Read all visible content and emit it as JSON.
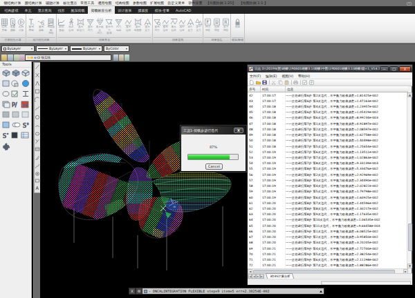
{
  "menubar": {
    "items": [
      "钢结构计算",
      "膜结构计算",
      "辅助计算",
      "标注显示",
      "常用工具",
      "通用绘图",
      "结构绘图",
      "参数绘图",
      "扩展绘图",
      "自定义菜单",
      "软件设置",
      "【出图比例 1:25】",
      "【绘图比例 1:1 】"
    ]
  },
  "tabbar": {
    "tabs": [
      {
        "label": "结构建模",
        "active": false
      },
      {
        "label": "单元",
        "active": false
      },
      {
        "label": "显示查询",
        "active": false
      },
      {
        "label": "找形",
        "active": false
      },
      {
        "label": "施加荷载",
        "active": false
      },
      {
        "label": "荷载效应分析",
        "active": true
      },
      {
        "label": "设计验算",
        "active": false
      },
      {
        "label": "膜裁剪",
        "active": false
      },
      {
        "label": "模块·变量",
        "active": false
      },
      {
        "label": "AutoCAD",
        "active": false
      }
    ],
    "minimize_icon": "chevron-up"
  },
  "ribbon": {
    "groups": [
      {
        "label": "自振特性计算",
        "items": [
          {
            "label": "结构\n类型",
            "icon": "grid"
          },
          {
            "label": "检查\n模型",
            "icon": "doc"
          },
          {
            "label": "结构\n计算",
            "icon": "play"
          }
        ]
      },
      {
        "label": "动力特性结果",
        "items": [
          {
            "label": "查询\n周期",
            "icon": "tletter"
          },
          {
            "label": "查询\n振型",
            "icon": "wave"
          },
          {
            "label": "周期振型\n报告",
            "icon": "report"
          }
        ]
      },
      {
        "label": "结果显示",
        "items": [
          {
            "label": "时程\n曲线",
            "icon": "curve"
          },
          {
            "label": "动态\n位移",
            "icon": "person"
          },
          {
            "label": "显示\n膜应力",
            "icon": "xmesh"
          },
          {
            "label": "显示\n内力",
            "icon": "vee"
          },
          {
            "label": "最大组合\n内力",
            "icon": "veemax"
          },
          {
            "label": "显示内力\n数值",
            "icon": "veenum"
          },
          {
            "label": "内力\n包络",
            "icon": "vee"
          },
          {
            "label": "显示\n位移",
            "icon": "zz"
          },
          {
            "label": "显示\n膜曲面",
            "icon": "xmesh"
          },
          {
            "label": "显示\n反力",
            "icon": "tri"
          }
        ]
      },
      {
        "label": "结果查询",
        "items": [
          {
            "label": "查询\n内力",
            "icon": "vq"
          },
          {
            "label": "查询\n位移",
            "icon": "zz"
          },
          {
            "label": "最大\n位移",
            "icon": "zmax"
          },
          {
            "label": "相对\n位移",
            "icon": "zz"
          },
          {
            "label": "单个\n反力",
            "icon": "tri"
          },
          {
            "label": "多个\n反力",
            "icon": "tri2"
          }
        ]
      },
      {
        "label": "结果报告",
        "items": [
          {
            "label": "内力\n报告",
            "icon": "boxF",
            "letter": "F"
          },
          {
            "label": "位移\n报告",
            "icon": "boxD",
            "letter": "D"
          },
          {
            "label": "反力\n报告",
            "icon": "boxR",
            "letter": "R"
          }
        ]
      },
      {
        "label": "锁定/解锁",
        "items": [
          {
            "label": "锁定",
            "icon": "lock"
          }
        ]
      }
    ]
  },
  "props_toolbar": {
    "color_value": "ByLayer",
    "linetype_value": "ByLayer",
    "lineweight_value": "ByLayer",
    "plotstyle_value": "ByColor",
    "layer_value": "细实线"
  },
  "palette": {
    "title": "Tools"
  },
  "dialog": {
    "title": "工况1-荷载步进行迭代",
    "close_label": "X",
    "percent_text": "87%",
    "progress_percent": 83,
    "cancel_label": "Cancel",
    "bar_color": "#35d43a"
  },
  "logwin": {
    "title": "日志 D:\\2019年图\\蝴蝶\\190601蝴蝶3.1(蝴蝶)中图\\190601蝴蝶3.1(蝴蝶)烟+1_V14.1",
    "menus": [
      "文件(F)",
      "编辑(E)",
      "视图(V)",
      "帮助(H)"
    ],
    "columns": [
      "序号",
      "时间",
      "信息"
    ],
    "rows": [
      {
        "no": "42",
        "time": "17:00:17",
        "msg": "——正在进行第6步 第2次迭代，不平衡力收敛误差=1.81425e-002"
      },
      {
        "no": "43",
        "time": "17:00:17",
        "msg": "——正在进行第6步 第3次迭代，不平衡力收敛误差=1.47163e-002"
      },
      {
        "no": "44",
        "time": "17:00:18",
        "msg": "——正在进行第6步 第4次迭代，不平衡力收敛误差=1.23957e-002"
      },
      {
        "no": "45",
        "time": "17:00:18",
        "msg": "——正在进行第6步 第5次迭代，不平衡力收敛误差=1.05419e-002"
      },
      {
        "no": "46",
        "time": "17:00:18",
        "msg": "——正在进行第6步 第6次迭代，不平衡力收敛误差=8.99234e-003"
      },
      {
        "no": "47",
        "time": "17:00:18",
        "msg": "——正在进行第7步 第1次迭代，不平衡力收敛误差=4.91897e-002"
      },
      {
        "no": "48",
        "time": "17:00:18",
        "msg": "——正在进行第7步 第2次迭代，不平衡力收敛误差=2.08597e-002"
      },
      {
        "no": "49",
        "time": "17:00:18",
        "msg": "——正在进行第7步 第3次迭代，不平衡力收敛误差=1.62758e-002"
      },
      {
        "no": "50",
        "time": "17:00:18",
        "msg": "——正在进行第7步 第4次迭代，不平衡力收敛误差=1.40498e-002"
      },
      {
        "no": "51",
        "time": "17:00:18",
        "msg": "——正在进行第7步 第5次迭代，不平衡力收敛误差=1.25654e-002"
      },
      {
        "no": "52",
        "time": "17:00:19",
        "msg": "——正在进行第7步 第6次迭代，不平衡力收敛误差=1.13511e-002"
      },
      {
        "no": "53",
        "time": "17:00:19",
        "msg": "——正在进行第7步 第7次迭代，不平衡力收敛误差=1.02863e-002"
      },
      {
        "no": "54",
        "time": "17:00:19",
        "msg": "——正在进行第7步 第8次迭代，不平衡力收敛误差=9.33139e-003"
      },
      {
        "no": "55",
        "time": "17:00:19",
        "msg": "——正在进行第8步 第1次迭代，不平衡力收敛误差=5.33476e-002"
      },
      {
        "no": "56",
        "time": "17:00:19",
        "msg": "——正在进行第8步 第2次迭代，不平衡力收敛误差=2.92969e-002"
      },
      {
        "no": "57",
        "time": "17:00:19",
        "msg": "——正在进行第8步 第3次迭代，不平衡力收敛误差=2.34490e-002"
      },
      {
        "no": "58",
        "time": "17:00:19",
        "msg": "——正在进行第8步 第4次迭代，不平衡力收敛误差=2.02822e-002"
      },
      {
        "no": "59",
        "time": "17:00:19",
        "msg": "——正在进行第8步 第5次迭代，不平衡力收敛误差=1.79798e-002"
      },
      {
        "no": "60",
        "time": "17:00:19",
        "msg": "——正在进行第8步 第6次迭代，不平衡力收敛误差=1.60925e-002"
      },
      {
        "no": "61",
        "time": "17:00:20",
        "msg": "——正在进行第8步 第7次迭代，不平衡力收敛误差=1.44596e-002"
      },
      {
        "no": "62",
        "time": "17:00:20",
        "msg": "——正在进行第8步 第8次迭代，不平衡力收敛误差=1.30217e-002"
      },
      {
        "no": "63",
        "time": "17:00:20",
        "msg": "——正在进行第8步 第9次迭代，不平衡力收敛误差=1.17635e-002"
      },
      {
        "no": "64",
        "time": "17:00:20",
        "msg": "——正在进行第8步 第10次迭代，不平衡力收敛误差=1.06535e-002"
      },
      {
        "no": "65",
        "time": "17:00:20",
        "msg": "——正在进行第8步 第11次迭代，不平衡力收敛误差=9.66458e-003"
      },
      {
        "no": "66",
        "time": "17:00:20",
        "msg": "——正在进行第9步 第1次迭代，不平衡力收敛误差=6.08525e-002"
      },
      {
        "no": "67",
        "time": "17:00:20",
        "msg": "——正在进行第9步 第2次迭代，不平衡力收敛误差=3.95850e-002"
      },
      {
        "no": "68",
        "time": "17:00:20",
        "msg": "——正在进行第9步 第3次迭代，不平衡力收敛误差=3.20205e-002"
      },
      {
        "no": "69",
        "time": "17:00:21",
        "msg": "——正在进行第9步 第4次迭代，不平衡力收敛误差=2.72700e-002"
      },
      {
        "no": "70",
        "time": "17:00:21",
        "msg": "——正在进行第9步 第5次迭代，不平衡力收敛误差=2.38254e-002"
      },
      {
        "no": "71",
        "time": "17:00:21",
        "msg": "——正在进行第9步 第6次迭代，不平衡力收敛误差=2.11198e-002"
      },
      {
        "no": "72",
        "time": "17:00:21",
        "msg": "——正在进行第9步 第7次迭代，不平衡力收敛误差=1.88286e-002"
      }
    ],
    "bottom_tab": "3D3S计算分析",
    "window_buttons": {
      "minimize": "—",
      "maximize": "□",
      "close": "X"
    }
  },
  "cmdbar": {
    "close_label": "X",
    "tools_icon": "wrench-icon",
    "text": "- DNCALINTEGRATION_FLEXIBLE   step=9   item=5   err=2.38254E-002"
  }
}
